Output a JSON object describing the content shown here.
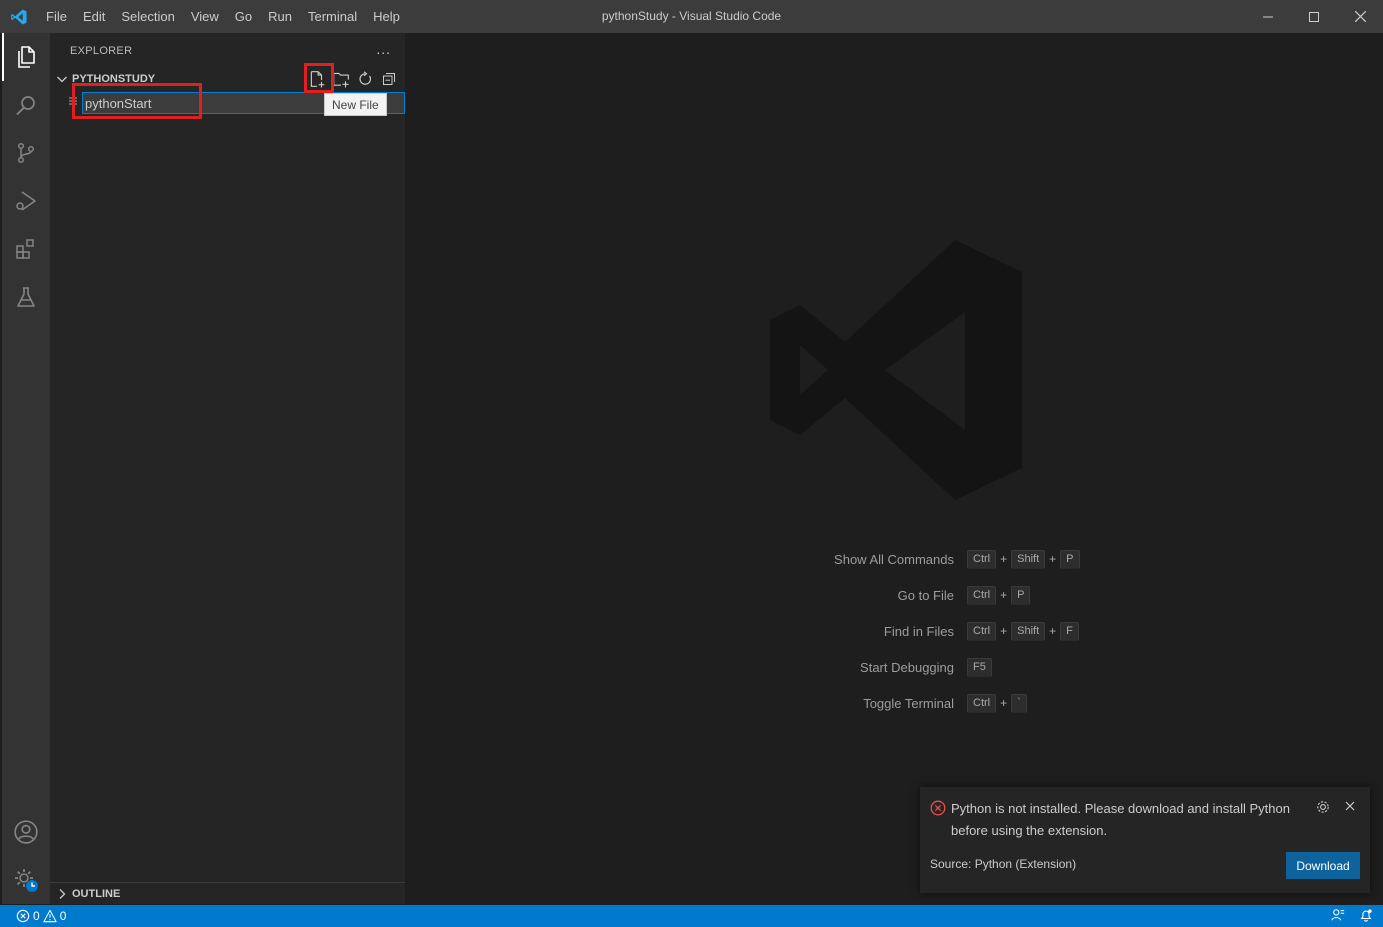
{
  "window": {
    "title": "pythonStudy - Visual Studio Code"
  },
  "menu": {
    "items": [
      "File",
      "Edit",
      "Selection",
      "View",
      "Go",
      "Run",
      "Terminal",
      "Help"
    ]
  },
  "sidebar": {
    "title": "EXPLORER",
    "more_label": "...",
    "folder_name": "PYTHONSTUDY",
    "new_file_value": "pythonStart",
    "tooltip": "New File",
    "outline_label": "OUTLINE"
  },
  "welcome": {
    "shortcuts": [
      {
        "label": "Show All Commands",
        "keys": [
          "Ctrl",
          "Shift",
          "P"
        ]
      },
      {
        "label": "Go to File",
        "keys": [
          "Ctrl",
          "P"
        ]
      },
      {
        "label": "Find in Files",
        "keys": [
          "Ctrl",
          "Shift",
          "F"
        ]
      },
      {
        "label": "Start Debugging",
        "keys": [
          "F5"
        ]
      },
      {
        "label": "Toggle Terminal",
        "keys": [
          "Ctrl",
          "`"
        ]
      }
    ]
  },
  "notification": {
    "message": "Python is not installed. Please download and install Python before using the extension.",
    "source": "Source: Python (Extension)",
    "button_label": "Download"
  },
  "status": {
    "errors": "0",
    "warnings": "0"
  },
  "colors": {
    "accent": "#007acc",
    "highlight": "#e02020",
    "button": "#0e639c",
    "error": "#f14c4c"
  }
}
